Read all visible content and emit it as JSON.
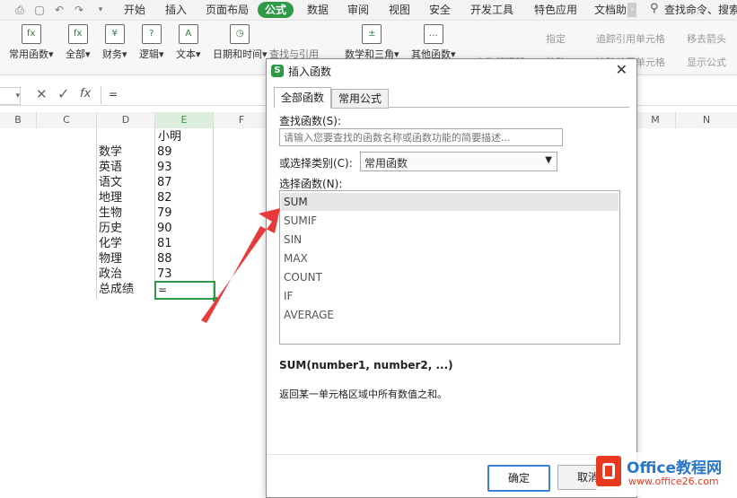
{
  "menubar": {
    "tabs": [
      "开始",
      "插入",
      "页面布局",
      "公式",
      "数据",
      "审阅",
      "视图",
      "安全",
      "开发工具",
      "特色应用",
      "文档助"
    ],
    "active": "公式",
    "search": "查找命令、搜索模"
  },
  "ribbon": {
    "groups": [
      "常用函数",
      "全部",
      "财务",
      "逻辑",
      "文本",
      "日期和时间",
      "查找与引用",
      "数学和三角",
      "其他函数"
    ],
    "right": [
      "名称管理器",
      "指定",
      "粘贴",
      "追踪引用单元格",
      "追踪从属单元格",
      "移去箭头",
      "显示公式"
    ]
  },
  "formula_bar": {
    "fx": "fx",
    "value": "="
  },
  "columns": [
    "B",
    "C",
    "D",
    "E",
    "F",
    "M",
    "N"
  ],
  "sheet": {
    "header": "小明",
    "rows": [
      {
        "subject": "数学",
        "score": "89"
      },
      {
        "subject": "英语",
        "score": "93"
      },
      {
        "subject": "语文",
        "score": "87"
      },
      {
        "subject": "地理",
        "score": "82"
      },
      {
        "subject": "生物",
        "score": "79"
      },
      {
        "subject": "历史",
        "score": "90"
      },
      {
        "subject": "化学",
        "score": "81"
      },
      {
        "subject": "物理",
        "score": "88"
      },
      {
        "subject": "政治",
        "score": "73"
      }
    ],
    "total_label": "总成绩",
    "total_value": "="
  },
  "dialog": {
    "title": "插入函数",
    "tabs": [
      "全部函数",
      "常用公式"
    ],
    "search_label": "查找函数(S):",
    "search_placeholder": "请输入您要查找的函数名称或函数功能的简要描述...",
    "category_label": "或选择类别(C):",
    "category_value": "常用函数",
    "list_label": "选择函数(N):",
    "functions": [
      "SUM",
      "SUMIF",
      "SIN",
      "MAX",
      "COUNT",
      "IF",
      "AVERAGE"
    ],
    "selected_function": "SUM",
    "signature": "SUM(number1, number2, ...)",
    "description": "返回某一单元格区域中所有数值之和。",
    "ok": "确定",
    "cancel": "取消"
  },
  "watermark": {
    "brand": "Office教程网",
    "url": "www.office26.com"
  },
  "colors": {
    "accent": "#2f9a45",
    "arrow": "#e8393b",
    "selection": "#e6e6e6"
  }
}
